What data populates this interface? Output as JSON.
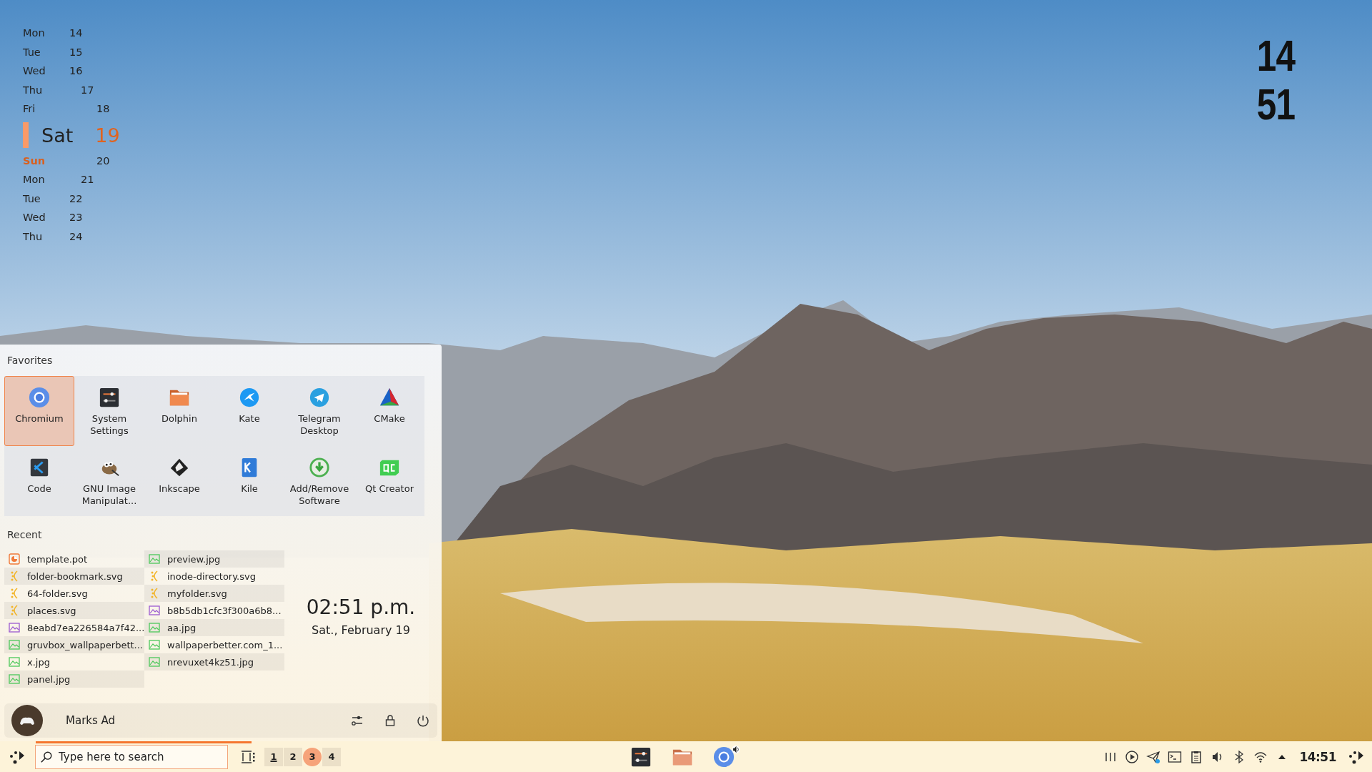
{
  "calendar_widget": {
    "days": [
      {
        "day": "Mon",
        "date": "14",
        "selected": false,
        "weekend": false
      },
      {
        "day": "Tue",
        "date": "15",
        "selected": false,
        "weekend": false
      },
      {
        "day": "Wed",
        "date": "16",
        "selected": false,
        "weekend": false
      },
      {
        "day": "Thu",
        "date": "17",
        "selected": false,
        "weekend": false
      },
      {
        "day": "Fri",
        "date": "18",
        "selected": false,
        "weekend": false
      },
      {
        "day": "Sat",
        "date": "19",
        "selected": true,
        "weekend": false
      },
      {
        "day": "Sun",
        "date": "20",
        "selected": false,
        "weekend": true
      },
      {
        "day": "Mon",
        "date": "21",
        "selected": false,
        "weekend": false
      },
      {
        "day": "Tue",
        "date": "22",
        "selected": false,
        "weekend": false
      },
      {
        "day": "Wed",
        "date": "23",
        "selected": false,
        "weekend": false
      },
      {
        "day": "Thu",
        "date": "24",
        "selected": false,
        "weekend": false
      }
    ]
  },
  "clock_widget": {
    "hours": "14",
    "minutes": "51"
  },
  "launcher": {
    "favorites": {
      "title": "Favorites",
      "apps": [
        {
          "label": "Chromium",
          "selected": true
        },
        {
          "label": "System Settings",
          "selected": false
        },
        {
          "label": "Dolphin",
          "selected": false
        },
        {
          "label": "Kate",
          "selected": false
        },
        {
          "label": "Telegram Desktop",
          "selected": false
        },
        {
          "label": "CMake",
          "selected": false
        },
        {
          "label": "Code",
          "selected": false
        },
        {
          "label": "GNU Image Manipulat...",
          "selected": false
        },
        {
          "label": "Inkscape",
          "selected": false
        },
        {
          "label": "Kile",
          "selected": false
        },
        {
          "label": "Add/Remove Software",
          "selected": false
        },
        {
          "label": "Qt Creator",
          "selected": false
        }
      ]
    },
    "recent": {
      "title": "Recent",
      "columns": [
        [
          {
            "name": "template.pot",
            "kind": "slides"
          },
          {
            "name": "folder-bookmark.svg",
            "kind": "vector"
          },
          {
            "name": "64-folder.svg",
            "kind": "vector"
          },
          {
            "name": "places.svg",
            "kind": "vector"
          },
          {
            "name": "8eabd7ea226584a7f42...",
            "kind": "graphic"
          },
          {
            "name": "gruvbox_wallpaperbett...",
            "kind": "photo"
          },
          {
            "name": "x.jpg",
            "kind": "photo"
          },
          {
            "name": "panel.jpg",
            "kind": "photo"
          }
        ],
        [
          {
            "name": "preview.jpg",
            "kind": "photo"
          },
          {
            "name": "inode-directory.svg",
            "kind": "vector"
          },
          {
            "name": "myfolder.svg",
            "kind": "vector"
          },
          {
            "name": "b8b5db1cfc3f300a6b8...",
            "kind": "graphic"
          },
          {
            "name": "aa.jpg",
            "kind": "photo"
          },
          {
            "name": "wallpaperbetter.com_1...",
            "kind": "photo"
          },
          {
            "name": "nrevuxet4kz51.jpg",
            "kind": "photo"
          }
        ]
      ]
    },
    "clock": {
      "time": "02:51 p.m.",
      "date": "Sat., February 19"
    },
    "user": {
      "name": "Marks Ad"
    }
  },
  "taskbar": {
    "search": {
      "placeholder": "Type here to search"
    },
    "desktops": [
      {
        "label": "1",
        "selected": false,
        "occupied": true
      },
      {
        "label": "2",
        "selected": false,
        "occupied": false
      },
      {
        "label": "3",
        "selected": true,
        "occupied": false
      },
      {
        "label": "4",
        "selected": false,
        "occupied": false
      }
    ],
    "tasks": [
      {
        "playing_audio": false
      },
      {
        "playing_audio": false
      },
      {
        "playing_audio": true
      }
    ],
    "clock": "14:51"
  }
}
